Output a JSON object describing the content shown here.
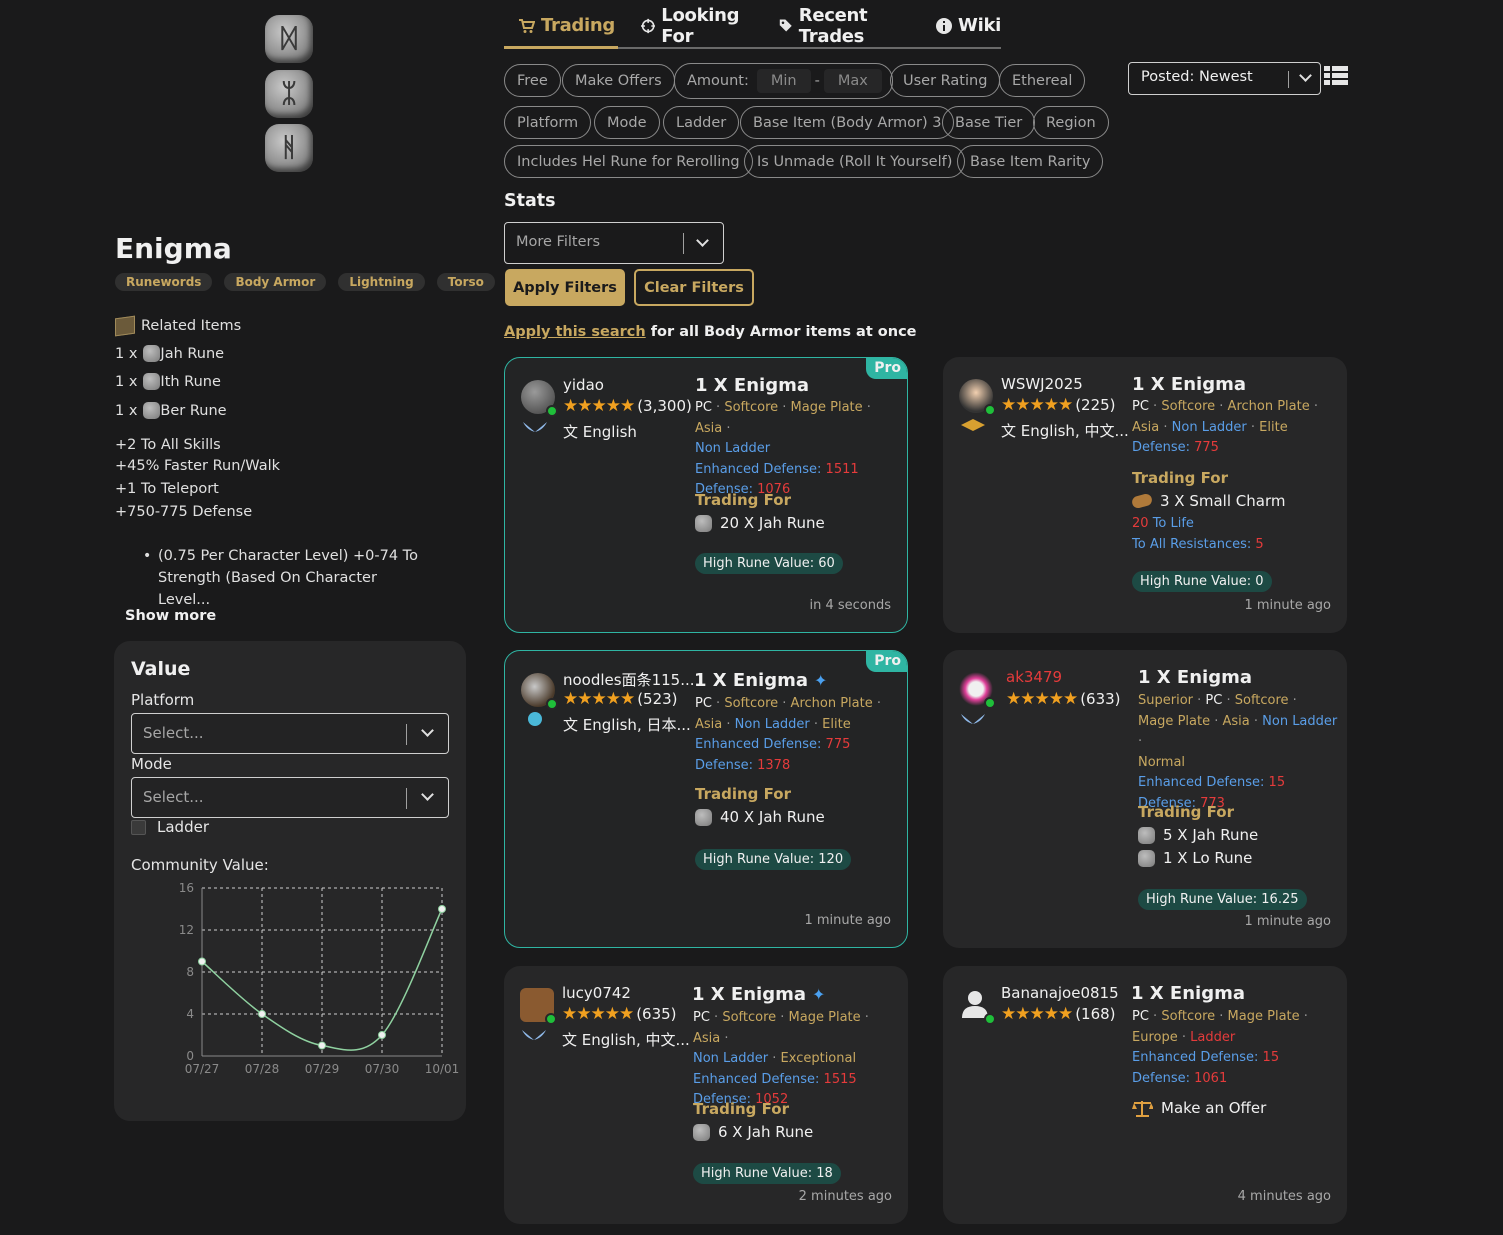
{
  "item": {
    "title": "Enigma",
    "tags": [
      "Runewords",
      "Body Armor",
      "Lightning",
      "Torso"
    ],
    "related_label": "Related Items",
    "runes": [
      {
        "qty": "1 x",
        "name": "Jah Rune"
      },
      {
        "qty": "1 x",
        "name": "Ith Rune"
      },
      {
        "qty": "1 x",
        "name": "Ber Rune"
      }
    ],
    "props": [
      "+2 To All Skills",
      "+45% Faster Run/Walk",
      "+1 To Teleport",
      "+750-775 Defense"
    ],
    "bullet": "(0.75 Per Character Level) +0-74 To Strength (Based On Character Level...",
    "show_more": "Show more"
  },
  "value_panel": {
    "title": "Value",
    "platform_label": "Platform",
    "platform_placeholder": "Select...",
    "mode_label": "Mode",
    "mode_placeholder": "Select...",
    "ladder_label": "Ladder",
    "community_label": "Community Value:"
  },
  "chart_data": {
    "type": "line",
    "title": "",
    "xlabel": "",
    "ylabel": "",
    "categories": [
      "07/27",
      "07/28",
      "07/29",
      "07/30",
      "10/01"
    ],
    "series": [
      {
        "values": [
          9,
          4,
          1,
          2,
          14
        ]
      }
    ],
    "ylim": [
      0,
      16
    ],
    "yticks": [
      0,
      4,
      8,
      12,
      16
    ],
    "grid": true,
    "color": "#8fd1a0"
  },
  "nav": {
    "tabs": [
      {
        "label": "Trading",
        "icon": "cart-icon",
        "active": true
      },
      {
        "label": "Looking For",
        "icon": "crosshair-icon",
        "active": false
      },
      {
        "label": "Recent Trades",
        "icon": "tag-icon",
        "active": false
      },
      {
        "label": "Wiki",
        "icon": "info-icon",
        "active": false
      }
    ]
  },
  "filters": {
    "chips_row1": [
      "Free",
      "Make Offers",
      "User Rating",
      "Ethereal"
    ],
    "amount_label": "Amount:",
    "amount_min": "Min",
    "amount_max": "Max",
    "chips_row2": [
      "Platform",
      "Mode",
      "Ladder",
      "Base Item (Body Armor) 3",
      "Base Tier",
      "Region"
    ],
    "chips_row3": [
      "Includes Hel Rune for Rerolling",
      "Is Unmade (Roll It Yourself)",
      "Base Item Rarity"
    ],
    "sort": "Posted: Newest",
    "stats_label": "Stats",
    "more_filters": "More Filters",
    "apply_label": "Apply Filters",
    "clear_label": "Clear Filters",
    "apply_search_link": "Apply this search",
    "apply_search_rest": " for all Body Armor items at once"
  },
  "cards": {
    "c1": {
      "pro": "Pro",
      "user": "yidao",
      "stars": "★★★★★",
      "count": "(3,300)",
      "lang": "English",
      "title": "1 X Enigma",
      "meta1": "PC",
      "meta2": "Softcore",
      "meta3": "Mage Plate",
      "meta4": "Asia",
      "meta5": "Non Ladder",
      "ed_label": "Enhanced Defense:",
      "ed": "1511",
      "def_label": "Defense:",
      "def": "1076",
      "tf_label": "Trading For",
      "tf1": "20 X Jah Rune",
      "hrv": "High Rune Value: 60",
      "time": "in 4 seconds"
    },
    "c2": {
      "user": "WSWJ2025",
      "stars": "★★★★★",
      "count": "(225)",
      "lang": "English, 中文...",
      "title": "1 X Enigma",
      "meta1": "PC",
      "meta2": "Softcore",
      "meta3": "Archon Plate",
      "meta4": "Asia",
      "meta5": "Non Ladder",
      "meta6": "Elite",
      "def_label": "Defense:",
      "def": "775",
      "tf_label": "Trading For",
      "tf1": "3 X Small Charm",
      "life_val": "20",
      "life_label": "To Life",
      "res_label": "To All Resistances:",
      "res_val": "5",
      "hrv": "High Rune Value: 0",
      "time": "1 minute ago"
    },
    "c3": {
      "pro": "Pro",
      "user": "noodles面条115...",
      "stars": "★★★★★",
      "count": "(523)",
      "lang": "English, 日本...",
      "title": "1 X Enigma",
      "meta1": "PC",
      "meta2": "Softcore",
      "meta3": "Archon Plate",
      "meta4": "Asia",
      "meta5": "Non Ladder",
      "meta6": "Elite",
      "ed_label": "Enhanced Defense:",
      "ed": "775",
      "def_label": "Defense:",
      "def": "1378",
      "tf_label": "Trading For",
      "tf1": "40 X Jah Rune",
      "hrv": "High Rune Value: 120",
      "time": "1 minute ago"
    },
    "c4": {
      "user": "ak3479",
      "stars": "★★★★★",
      "count": "(633)",
      "title": "1 X Enigma",
      "meta0": "Superior",
      "meta1": "PC",
      "meta2": "Softcore",
      "meta3": "Mage Plate",
      "meta4": "Asia",
      "meta5": "Non Ladder",
      "meta6": "Normal",
      "ed_label": "Enhanced Defense:",
      "ed": "15",
      "def_label": "Defense:",
      "def": "773",
      "tf_label": "Trading For",
      "tf1": "5 X Jah Rune",
      "tf2": "1 X Lo Rune",
      "hrv": "High Rune Value: 16.25",
      "time": "1 minute ago"
    },
    "c5": {
      "user": "lucy0742",
      "stars": "★★★★★",
      "count": "(635)",
      "lang": "English, 中文...",
      "title": "1 X Enigma",
      "meta1": "PC",
      "meta2": "Softcore",
      "meta3": "Mage Plate",
      "meta4": "Asia",
      "meta5": "Non Ladder",
      "meta6": "Exceptional",
      "ed_label": "Enhanced Defense:",
      "ed": "1515",
      "def_label": "Defense:",
      "def": "1052",
      "tf_label": "Trading For",
      "tf1": "6 X Jah Rune",
      "hrv": "High Rune Value: 18",
      "time": "2 minutes ago"
    },
    "c6": {
      "user": "Bananajoe0815",
      "stars": "★★★★★",
      "count": "(168)",
      "title": "1 X Enigma",
      "meta1": "PC",
      "meta2": "Softcore",
      "meta3": "Mage Plate",
      "meta4": "Europe",
      "meta5": "Ladder",
      "ed_label": "Enhanced Defense:",
      "ed": "15",
      "def_label": "Defense:",
      "def": "1061",
      "offer": "Make an Offer",
      "time": "4 minutes ago"
    }
  }
}
